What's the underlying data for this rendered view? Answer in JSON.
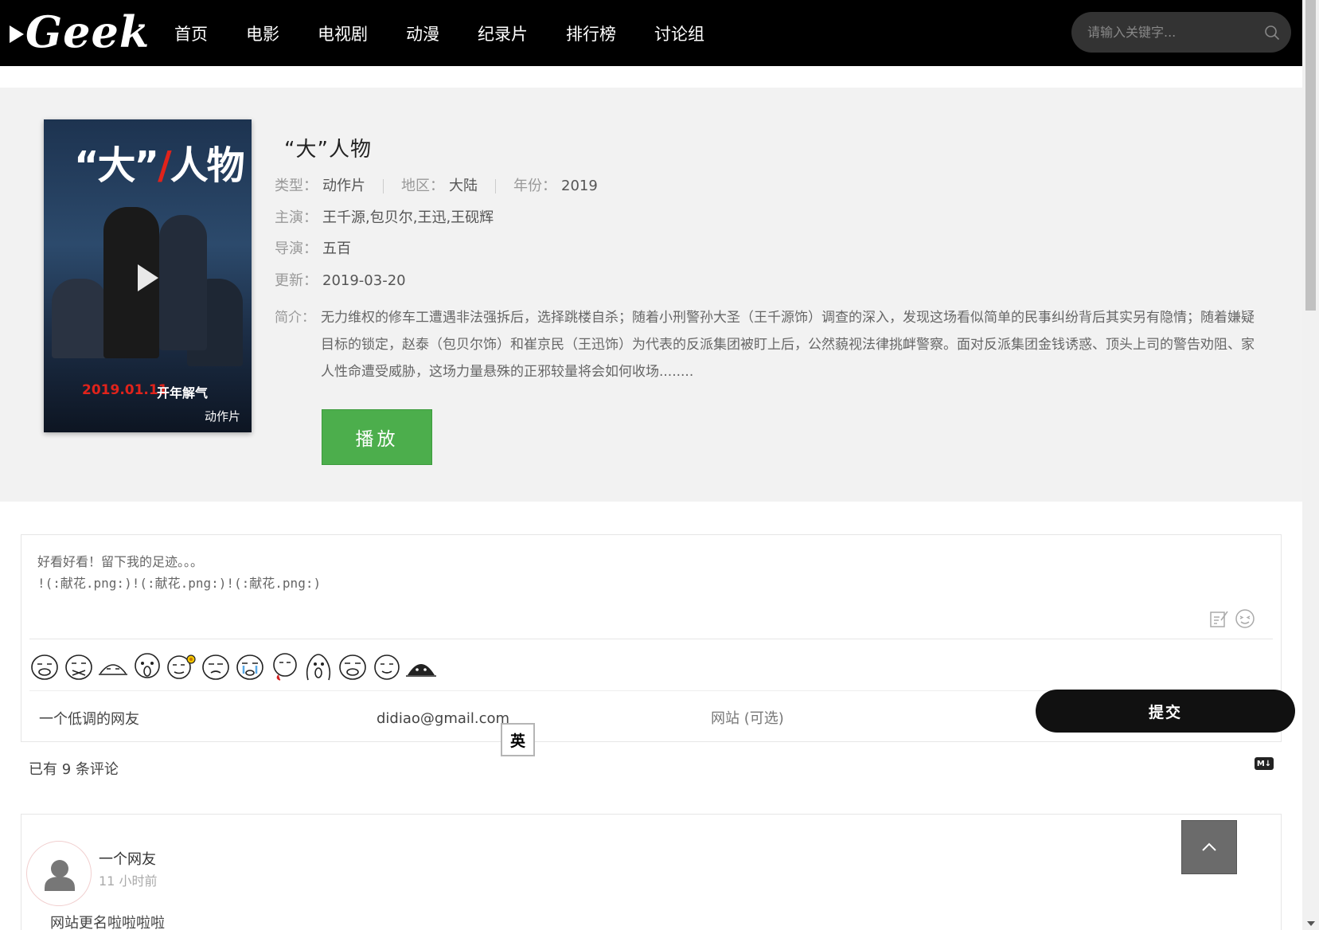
{
  "header": {
    "logo_text": "Geek",
    "nav": [
      "首页",
      "电影",
      "电视剧",
      "动漫",
      "纪录片",
      "排行榜",
      "讨论组"
    ],
    "search_placeholder": "请输入关键字..."
  },
  "movie": {
    "poster_title_left": "“大”",
    "poster_title_right": "人物",
    "poster_date": "2019.01.11",
    "poster_release": "开年解气",
    "poster_tag": "动作片",
    "title": "“大”人物",
    "type_label": "类型：",
    "type_value": "动作片",
    "region_label": "地区：",
    "region_value": "大陆",
    "year_label": "年份：",
    "year_value": "2019",
    "cast_label": "主演：",
    "cast_value": "王千源,包贝尔,王迅,王砚辉",
    "director_label": "导演：",
    "director_value": "五百",
    "updated_label": "更新：",
    "updated_value": "2019-03-20",
    "intro_label": "简介：",
    "intro_value": "无力维权的修车工遭遇非法强拆后，选择跳楼自杀；随着小刑警孙大圣（王千源饰）调查的深入，发现这场看似简单的民事纠纷背后其实另有隐情；随着嫌疑目标的锁定，赵泰（包贝尔饰）和崔京民（王迅饰）为代表的反派集团被盯上后，公然藐视法律挑衅警察。面对反派集团金钱诱惑、顶头上司的警告劝阻、家人性命遭受威胁，这场力量悬殊的正邪较量将会如何收场........",
    "play_label": "播放"
  },
  "comment_form": {
    "text": "好看好看！留下我的足迹。。。\n!(:献花.png:)!(:献花.png:)!(:献花.png:)",
    "name_value": "一个低调的网友",
    "email_value": "didiao@gmail.com",
    "site_placeholder": "网站 (可选)",
    "submit_label": "提交",
    "ime_label": "英"
  },
  "comment_count": "已有 9 条评论",
  "md_badge": "M↓",
  "comments": [
    {
      "name": "一个网友",
      "time": "11 小时前",
      "text": "网站更名啦啦啦啦"
    }
  ],
  "colors": {
    "play_button": "#4cae4c",
    "header_bg": "#000000",
    "detail_bg": "#f2f2f2",
    "submit_bg": "#111111"
  }
}
